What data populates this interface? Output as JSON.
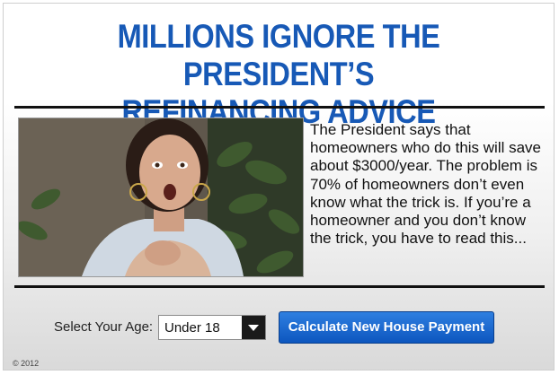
{
  "headline": {
    "line1": "MILLIONS IGNORE THE PRESIDENT’S",
    "line2": "REFINANCING ADVICE"
  },
  "body_text": "The President says that homeowners who do this will save about $3000/year. The problem is 70% of homeowners don’t even know what the trick is. If you’re a homeowner and you don’t know the trick, you have to read this...",
  "form": {
    "age_label": "Select Your Age:",
    "age_selected": "Under 18",
    "button_label": "Calculate New House Payment"
  },
  "footer": {
    "copyright": "© 2012"
  },
  "colors": {
    "headline": "#1759b6",
    "button": "#0d56bf",
    "rule": "#111111"
  }
}
